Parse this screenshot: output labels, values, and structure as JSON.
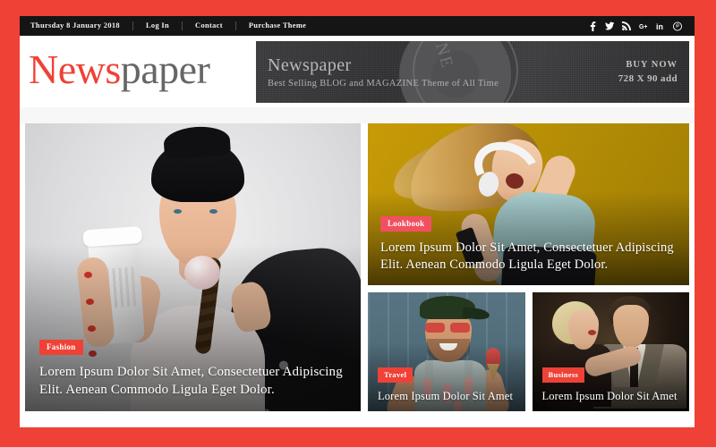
{
  "theme": {
    "frame_color": "#ef4136",
    "accent_color": "#ef4136",
    "badge_alt_color": "#f15060",
    "topbar_color": "#151515"
  },
  "topbar": {
    "date": "Thursday 8 January 2018",
    "links": [
      "Log In",
      "Contact",
      "Purchase Theme"
    ],
    "social": [
      {
        "name": "facebook-icon",
        "label": "f"
      },
      {
        "name": "twitter-icon",
        "label": "t"
      },
      {
        "name": "rss-icon",
        "label": "rss"
      },
      {
        "name": "google-plus-icon",
        "label": "G+"
      },
      {
        "name": "linkedin-icon",
        "label": "in"
      },
      {
        "name": "pinterest-icon",
        "label": "P"
      }
    ]
  },
  "masthead": {
    "logo_part_one": "News",
    "logo_part_two": "paper",
    "banner": {
      "title": "Newspaper",
      "subtitle": "Best Selling BLOG and MAGAZINE Theme of All Time",
      "cta_line_one": "BUY NOW",
      "cta_line_two": "728 X 90 add"
    }
  },
  "posts": {
    "hero": {
      "category": "Fashion",
      "title": "Lorem Ipsum Dolor Sit Amet, Consectetuer Adipiscing Elit. Aenean Commodo Ligula Eget Dolor."
    },
    "lookbook": {
      "category": "Lookbook",
      "title": "Lorem Ipsum Dolor Sit Amet, Consectetuer Adipiscing Elit. Aenean Commodo Ligula Eget Dolor."
    },
    "travel": {
      "category": "Travel",
      "title": "Lorem Ipsum Dolor Sit Amet"
    },
    "business": {
      "category": "Business",
      "title": "Lorem Ipsum Dolor Sit Amet"
    }
  }
}
